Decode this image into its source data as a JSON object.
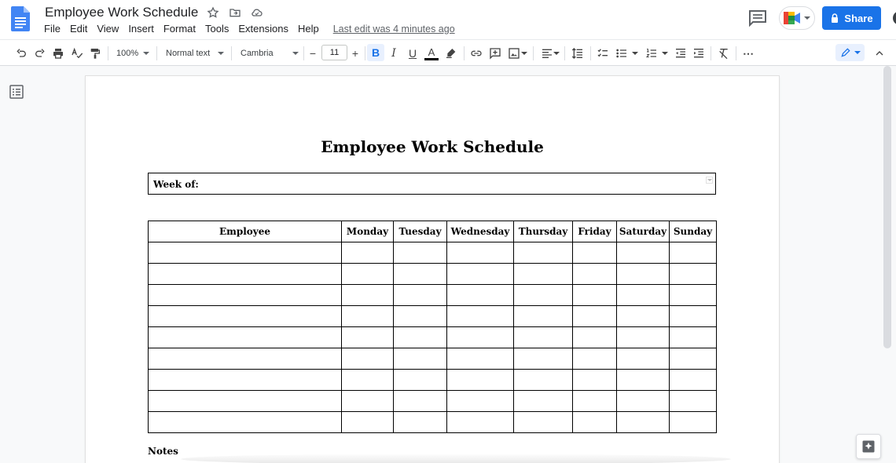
{
  "app": {
    "title": "Employee Work Schedule",
    "last_edit": "Last edit was 4 minutes ago",
    "share_label": "Share",
    "accent_color": "#1a73e8"
  },
  "menu": [
    "File",
    "Edit",
    "View",
    "Insert",
    "Format",
    "Tools",
    "Extensions",
    "Help"
  ],
  "toolbar": {
    "zoom": "100%",
    "style": "Normal text",
    "font": "Cambria",
    "font_size": "11",
    "minus": "−",
    "plus": "+",
    "bold": "B",
    "italic": "I",
    "underline": "U",
    "text_color": "A",
    "more": "⋯"
  },
  "document": {
    "heading": "Employee Work Schedule",
    "week_label": "Week of:",
    "columns": [
      "Employee",
      "Monday",
      "Tuesday",
      "Wednesday",
      "Thursday",
      "Friday",
      "Saturday",
      "Sunday"
    ],
    "notes_label": "Notes"
  }
}
